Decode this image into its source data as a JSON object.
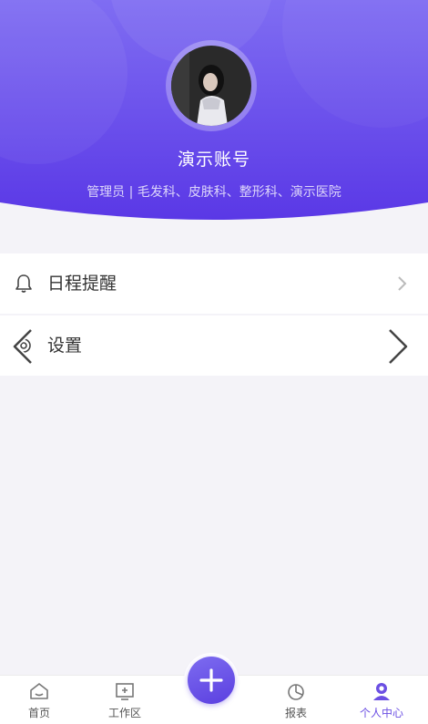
{
  "profile": {
    "account_name": "演示账号",
    "role_line": "管理员 | 毛发科、皮肤科、整形科、演示医院",
    "avatar_icon": "user-avatar-photo"
  },
  "menu": {
    "items": [
      {
        "label": "日程提醒",
        "icon": "bell-icon"
      },
      {
        "label": "设置",
        "icon": "gear-icon"
      }
    ]
  },
  "tabbar": {
    "tabs": [
      {
        "label": "首页",
        "icon": "home-icon",
        "active": false
      },
      {
        "label": "工作区",
        "icon": "workspace-icon",
        "active": false
      },
      {
        "label": "报表",
        "icon": "pie-chart-icon",
        "active": false
      },
      {
        "label": "个人中心",
        "icon": "user-center-icon",
        "active": true
      }
    ],
    "fab_icon": "plus-icon"
  },
  "colors": {
    "header_start": "#7f6df2",
    "header_end": "#5a38e6",
    "accent": "#6b4fe3",
    "page_bg": "#f4f3f8"
  }
}
